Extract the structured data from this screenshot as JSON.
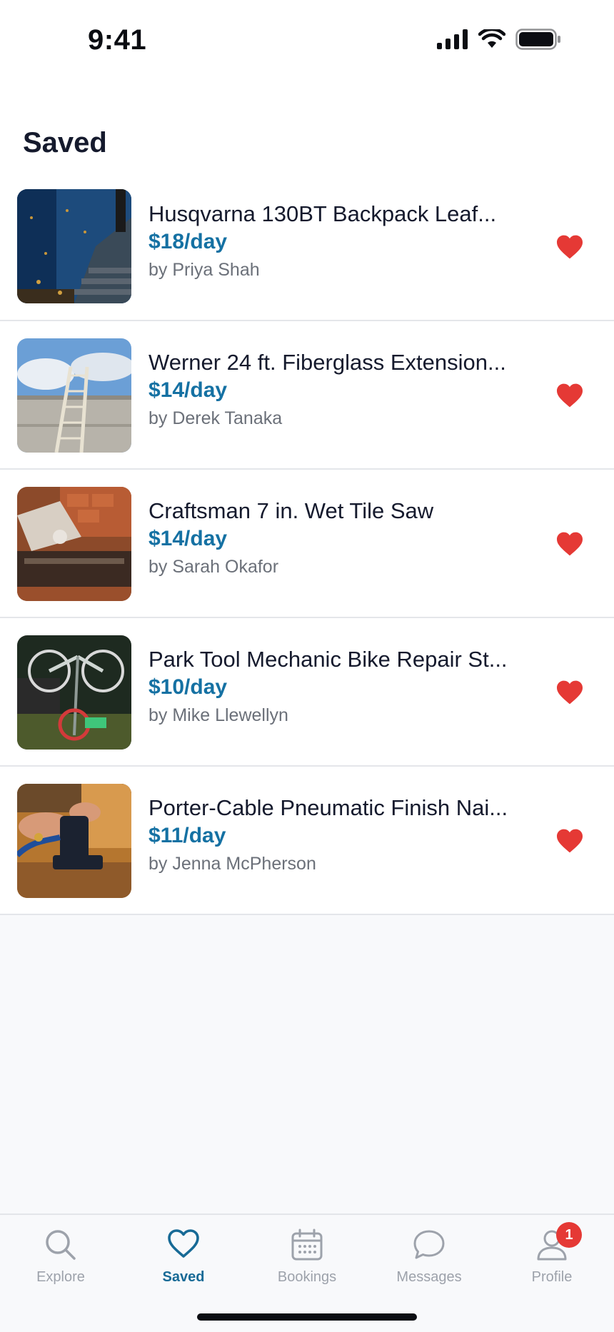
{
  "status_bar": {
    "time": "9:41"
  },
  "page": {
    "title": "Saved"
  },
  "items": [
    {
      "title": "Husqvarna 130BT Backpack Leaf...",
      "price": "$18/day",
      "owner": "by Priya Shah",
      "thumb": "leaf-blower-photo"
    },
    {
      "title": "Werner 24 ft. Fiberglass Extension...",
      "price": "$14/day",
      "owner": "by Derek Tanaka",
      "thumb": "ladder-photo"
    },
    {
      "title": "Craftsman 7 in. Wet Tile Saw",
      "price": "$14/day",
      "owner": "by Sarah Okafor",
      "thumb": "tile-saw-photo"
    },
    {
      "title": "Park Tool Mechanic Bike Repair St...",
      "price": "$10/day",
      "owner": "by Mike Llewellyn",
      "thumb": "bike-stand-photo"
    },
    {
      "title": "Porter-Cable Pneumatic Finish Nai...",
      "price": "$11/day",
      "owner": "by Jenna McPherson",
      "thumb": "nailer-photo"
    }
  ],
  "tabs": [
    {
      "label": "Explore",
      "icon": "search-icon"
    },
    {
      "label": "Saved",
      "icon": "heart-icon",
      "active": true
    },
    {
      "label": "Bookings",
      "icon": "calendar-icon"
    },
    {
      "label": "Messages",
      "icon": "chat-bubble-icon"
    },
    {
      "label": "Profile",
      "icon": "person-icon",
      "badge": "1"
    }
  ],
  "colors": {
    "accent": "#1571a3",
    "heart": "#e53935",
    "badge": "#e53935"
  }
}
